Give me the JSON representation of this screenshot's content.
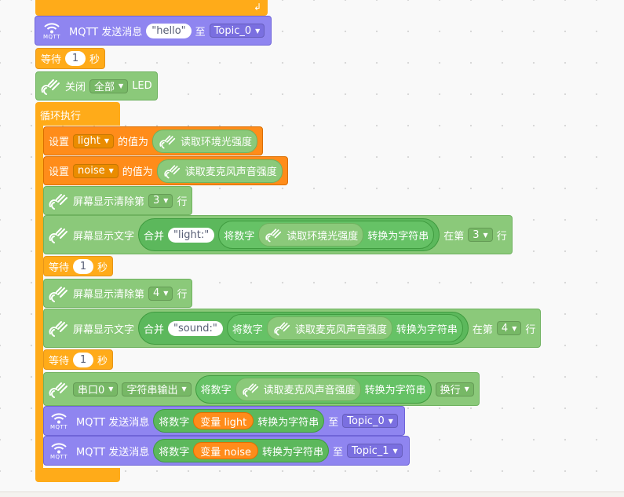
{
  "colors": {
    "orange_control": "#ffab19",
    "orange_data": "#ff8c1a",
    "green_sensor": "#8bc97a",
    "green_operator": "#5cb85c",
    "purple_mqtt": "#8f85f0"
  },
  "blocks": {
    "mqtt_send_hello": {
      "label": "MQTT 发送消息",
      "message": "hello",
      "to": "至",
      "topic": "Topic_0",
      "icon_label": "MQTT"
    },
    "wait1": {
      "prefix": "等待",
      "value": "1",
      "unit": "秒"
    },
    "close_led": {
      "label": "关闭",
      "option": "全部",
      "suffix": "LED"
    },
    "forever": {
      "label": "循环执行"
    },
    "set_light": {
      "label": "设置",
      "var": "light",
      "mid": "的值为",
      "reporter": "读取环境光强度"
    },
    "set_noise": {
      "label": "设置",
      "var": "noise",
      "mid": "的值为",
      "reporter": "读取麦克风声音强度"
    },
    "clear_row3": {
      "label": "屏幕显示清除第",
      "row": "3",
      "suffix": "行"
    },
    "show_light": {
      "label": "屏幕显示文字",
      "join": "合并",
      "text": "light:",
      "to_num": "将数字",
      "reporter": "读取环境光强度",
      "to_str": "转换为字符串",
      "at": "在第",
      "row": "3",
      "suffix": "行"
    },
    "wait2": {
      "prefix": "等待",
      "value": "1",
      "unit": "秒"
    },
    "clear_row4": {
      "label": "屏幕显示清除第",
      "row": "4",
      "suffix": "行"
    },
    "show_sound": {
      "label": "屏幕显示文字",
      "join": "合并",
      "text": "sound:",
      "to_num": "将数字",
      "reporter": "读取麦克风声音强度",
      "to_str": "转换为字符串",
      "at": "在第",
      "row": "4",
      "suffix": "行"
    },
    "wait3": {
      "prefix": "等待",
      "value": "1",
      "unit": "秒"
    },
    "serial_out": {
      "port": "串口0",
      "mode": "字符串输出",
      "to_num": "将数字",
      "reporter": "读取麦克风声音强度",
      "to_str": "转换为字符串",
      "newline": "换行"
    },
    "mqtt_light": {
      "label": "MQTT 发送消息",
      "to_num": "将数字",
      "var": "变量 light",
      "to_str": "转换为字符串",
      "to": "至",
      "topic": "Topic_0",
      "icon_label": "MQTT"
    },
    "mqtt_noise": {
      "label": "MQTT 发送消息",
      "to_num": "将数字",
      "var": "变量 noise",
      "to_str": "转换为字符串",
      "to": "至",
      "topic": "Topic_1",
      "icon_label": "MQTT"
    }
  }
}
